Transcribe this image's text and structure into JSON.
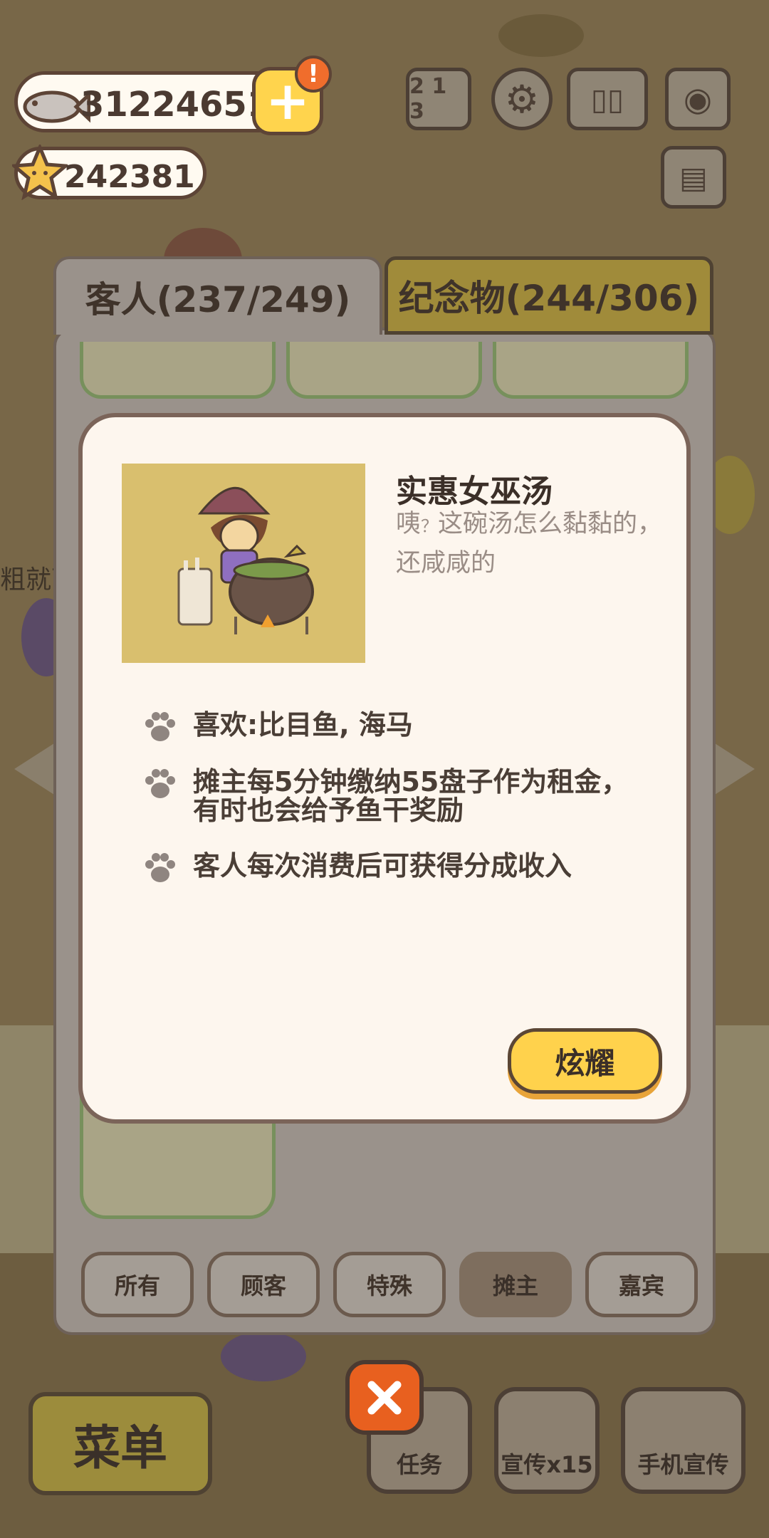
{
  "currency": {
    "fish": "312246510",
    "stars": "242381",
    "alert": "!"
  },
  "background_text": "粗就可",
  "tabs": {
    "customers": "客人(237/249)",
    "souvenirs": "纪念物(244/306)"
  },
  "detail": {
    "title": "实惠女巫汤",
    "desc_part1": "咦",
    "desc_q": "？",
    "desc_part2": "这碗汤怎么黏黏的，还咸咸的",
    "likes": "喜欢:比目鱼, 海马",
    "rent_line1": "摊主每5分钟缴纳55盘子作为租金，",
    "rent_line2": "有时也会给予鱼干奖励",
    "share": "客人每次消费后可获得分成收入",
    "show_off_button": "炫耀"
  },
  "filters": [
    {
      "label": "所有",
      "selected": false
    },
    {
      "label": "顾客",
      "selected": false
    },
    {
      "label": "特殊",
      "selected": false
    },
    {
      "label": "摊主",
      "selected": true
    },
    {
      "label": "嘉宾",
      "selected": false
    }
  ],
  "bottom_bar": {
    "menu": "菜单",
    "tasks": "任务",
    "promote": "宣传x15",
    "phone_promote": "手机宣传"
  },
  "colors": {
    "accent_yellow": "#ffd24c",
    "close_orange": "#e8601f",
    "modal_bg": "#fdf6ee",
    "card_border_green": "#77905c"
  },
  "icons": {
    "fish": "fish-icon",
    "star": "star-icon",
    "plus": "plus-icon",
    "ranking": "ranking-icon",
    "settings": "gear-icon",
    "guide": "book-icon",
    "camera": "camera-icon",
    "news": "newspaper-icon",
    "paw": "paw-icon",
    "close": "close-icon"
  }
}
